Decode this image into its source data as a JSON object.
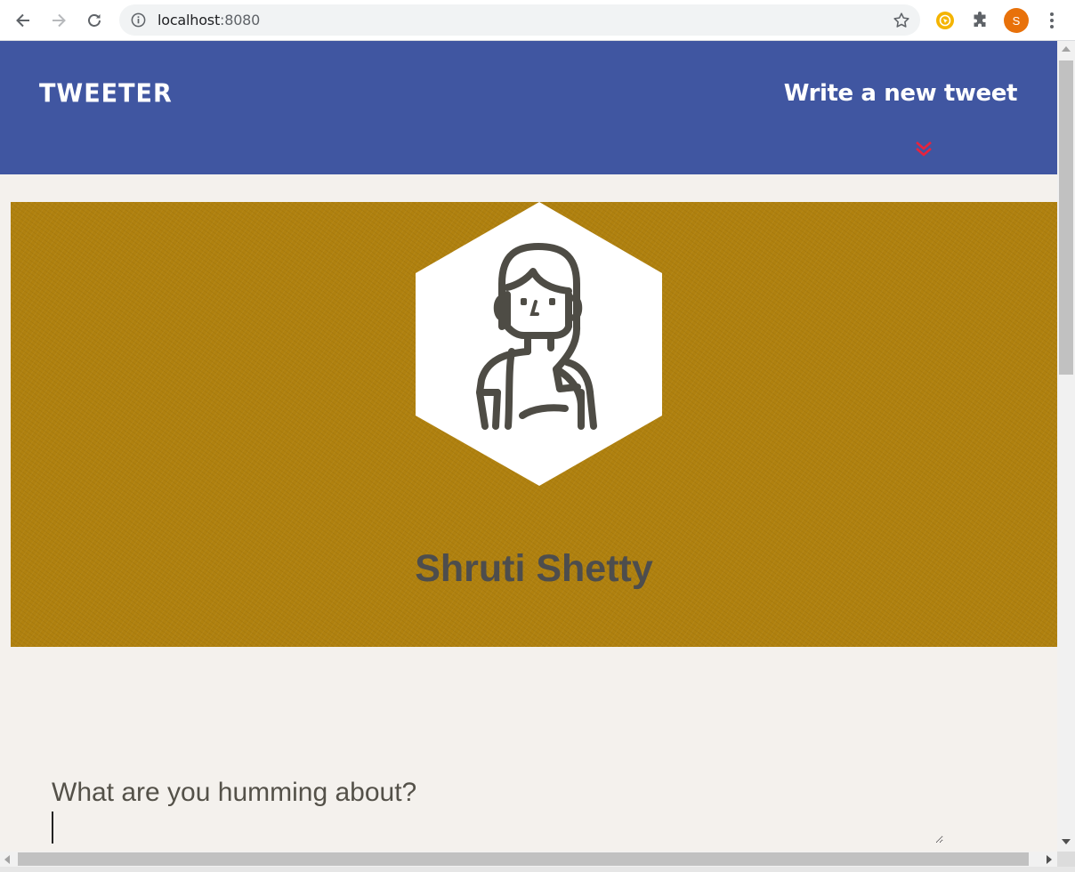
{
  "browser": {
    "url_host": "localhost",
    "url_port": ":8080",
    "profile_initial": "S",
    "icons": {
      "back": "arrow-left-icon",
      "forward": "arrow-right-icon",
      "reload": "reload-icon",
      "site_info": "info-icon",
      "bookmark": "star-icon",
      "extension_1": "extension-icon",
      "extensions": "puzzle-icon",
      "menu": "kebab-menu-icon"
    }
  },
  "header": {
    "logo": "TWEETER",
    "compose_label": "Write a new tweet",
    "compose_icon": "double-chevron-down-icon"
  },
  "profile": {
    "name": "Shruti Shetty",
    "avatar_icon": "woman-avatar-icon"
  },
  "composer": {
    "prompt": "What are you humming about?",
    "value": ""
  },
  "colors": {
    "header_bg": "#4056a1",
    "banner_bg": "#b0810f",
    "page_bg": "#f4f1ed",
    "toggle_accent": "#e8233d",
    "text_dark": "#4d4d4d"
  }
}
